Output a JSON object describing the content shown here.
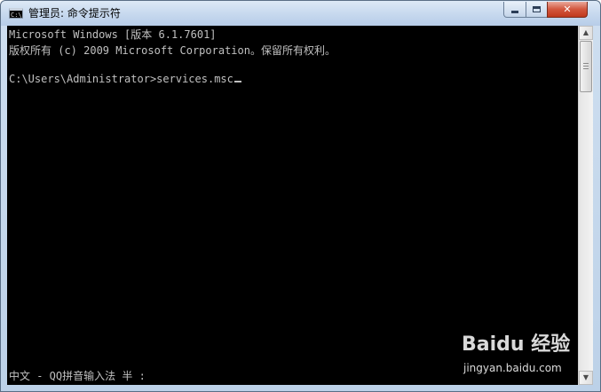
{
  "window": {
    "title": "管理员: 命令提示符",
    "controls": {
      "minimize_icon": "minimize-icon",
      "maximize_icon": "maximize-icon",
      "close_icon": "close-icon",
      "close_label": "✕"
    }
  },
  "console": {
    "lines": [
      "Microsoft Windows [版本 6.1.7601]",
      "版权所有 (c) 2009 Microsoft Corporation。保留所有权利。",
      "",
      "C:\\Users\\Administrator>services.msc"
    ],
    "ime_status": "中文 - QQ拼音输入法 半 :"
  },
  "watermark": {
    "logo": "Baidu 经验",
    "url": "jingyan.baidu.com"
  },
  "colors": {
    "console_bg": "#000000",
    "console_fg": "#c0c0c0",
    "close_button": "#c7432a"
  }
}
